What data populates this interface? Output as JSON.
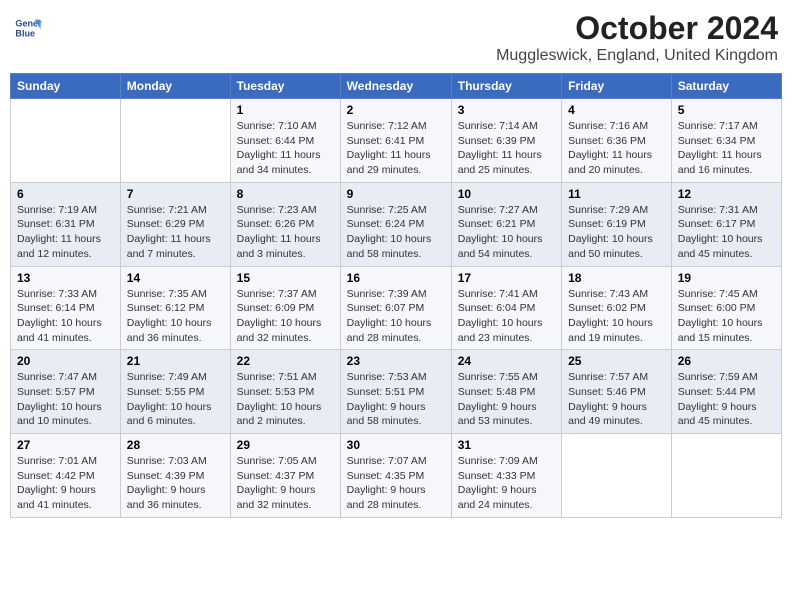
{
  "header": {
    "logo_line1": "General",
    "logo_line2": "Blue",
    "title": "October 2024",
    "subtitle": "Muggleswick, England, United Kingdom"
  },
  "days_of_week": [
    "Sunday",
    "Monday",
    "Tuesday",
    "Wednesday",
    "Thursday",
    "Friday",
    "Saturday"
  ],
  "weeks": [
    [
      {
        "day": "",
        "sunrise": "",
        "sunset": "",
        "daylight": ""
      },
      {
        "day": "",
        "sunrise": "",
        "sunset": "",
        "daylight": ""
      },
      {
        "day": "1",
        "sunrise": "Sunrise: 7:10 AM",
        "sunset": "Sunset: 6:44 PM",
        "daylight": "Daylight: 11 hours and 34 minutes."
      },
      {
        "day": "2",
        "sunrise": "Sunrise: 7:12 AM",
        "sunset": "Sunset: 6:41 PM",
        "daylight": "Daylight: 11 hours and 29 minutes."
      },
      {
        "day": "3",
        "sunrise": "Sunrise: 7:14 AM",
        "sunset": "Sunset: 6:39 PM",
        "daylight": "Daylight: 11 hours and 25 minutes."
      },
      {
        "day": "4",
        "sunrise": "Sunrise: 7:16 AM",
        "sunset": "Sunset: 6:36 PM",
        "daylight": "Daylight: 11 hours and 20 minutes."
      },
      {
        "day": "5",
        "sunrise": "Sunrise: 7:17 AM",
        "sunset": "Sunset: 6:34 PM",
        "daylight": "Daylight: 11 hours and 16 minutes."
      }
    ],
    [
      {
        "day": "6",
        "sunrise": "Sunrise: 7:19 AM",
        "sunset": "Sunset: 6:31 PM",
        "daylight": "Daylight: 11 hours and 12 minutes."
      },
      {
        "day": "7",
        "sunrise": "Sunrise: 7:21 AM",
        "sunset": "Sunset: 6:29 PM",
        "daylight": "Daylight: 11 hours and 7 minutes."
      },
      {
        "day": "8",
        "sunrise": "Sunrise: 7:23 AM",
        "sunset": "Sunset: 6:26 PM",
        "daylight": "Daylight: 11 hours and 3 minutes."
      },
      {
        "day": "9",
        "sunrise": "Sunrise: 7:25 AM",
        "sunset": "Sunset: 6:24 PM",
        "daylight": "Daylight: 10 hours and 58 minutes."
      },
      {
        "day": "10",
        "sunrise": "Sunrise: 7:27 AM",
        "sunset": "Sunset: 6:21 PM",
        "daylight": "Daylight: 10 hours and 54 minutes."
      },
      {
        "day": "11",
        "sunrise": "Sunrise: 7:29 AM",
        "sunset": "Sunset: 6:19 PM",
        "daylight": "Daylight: 10 hours and 50 minutes."
      },
      {
        "day": "12",
        "sunrise": "Sunrise: 7:31 AM",
        "sunset": "Sunset: 6:17 PM",
        "daylight": "Daylight: 10 hours and 45 minutes."
      }
    ],
    [
      {
        "day": "13",
        "sunrise": "Sunrise: 7:33 AM",
        "sunset": "Sunset: 6:14 PM",
        "daylight": "Daylight: 10 hours and 41 minutes."
      },
      {
        "day": "14",
        "sunrise": "Sunrise: 7:35 AM",
        "sunset": "Sunset: 6:12 PM",
        "daylight": "Daylight: 10 hours and 36 minutes."
      },
      {
        "day": "15",
        "sunrise": "Sunrise: 7:37 AM",
        "sunset": "Sunset: 6:09 PM",
        "daylight": "Daylight: 10 hours and 32 minutes."
      },
      {
        "day": "16",
        "sunrise": "Sunrise: 7:39 AM",
        "sunset": "Sunset: 6:07 PM",
        "daylight": "Daylight: 10 hours and 28 minutes."
      },
      {
        "day": "17",
        "sunrise": "Sunrise: 7:41 AM",
        "sunset": "Sunset: 6:04 PM",
        "daylight": "Daylight: 10 hours and 23 minutes."
      },
      {
        "day": "18",
        "sunrise": "Sunrise: 7:43 AM",
        "sunset": "Sunset: 6:02 PM",
        "daylight": "Daylight: 10 hours and 19 minutes."
      },
      {
        "day": "19",
        "sunrise": "Sunrise: 7:45 AM",
        "sunset": "Sunset: 6:00 PM",
        "daylight": "Daylight: 10 hours and 15 minutes."
      }
    ],
    [
      {
        "day": "20",
        "sunrise": "Sunrise: 7:47 AM",
        "sunset": "Sunset: 5:57 PM",
        "daylight": "Daylight: 10 hours and 10 minutes."
      },
      {
        "day": "21",
        "sunrise": "Sunrise: 7:49 AM",
        "sunset": "Sunset: 5:55 PM",
        "daylight": "Daylight: 10 hours and 6 minutes."
      },
      {
        "day": "22",
        "sunrise": "Sunrise: 7:51 AM",
        "sunset": "Sunset: 5:53 PM",
        "daylight": "Daylight: 10 hours and 2 minutes."
      },
      {
        "day": "23",
        "sunrise": "Sunrise: 7:53 AM",
        "sunset": "Sunset: 5:51 PM",
        "daylight": "Daylight: 9 hours and 58 minutes."
      },
      {
        "day": "24",
        "sunrise": "Sunrise: 7:55 AM",
        "sunset": "Sunset: 5:48 PM",
        "daylight": "Daylight: 9 hours and 53 minutes."
      },
      {
        "day": "25",
        "sunrise": "Sunrise: 7:57 AM",
        "sunset": "Sunset: 5:46 PM",
        "daylight": "Daylight: 9 hours and 49 minutes."
      },
      {
        "day": "26",
        "sunrise": "Sunrise: 7:59 AM",
        "sunset": "Sunset: 5:44 PM",
        "daylight": "Daylight: 9 hours and 45 minutes."
      }
    ],
    [
      {
        "day": "27",
        "sunrise": "Sunrise: 7:01 AM",
        "sunset": "Sunset: 4:42 PM",
        "daylight": "Daylight: 9 hours and 41 minutes."
      },
      {
        "day": "28",
        "sunrise": "Sunrise: 7:03 AM",
        "sunset": "Sunset: 4:39 PM",
        "daylight": "Daylight: 9 hours and 36 minutes."
      },
      {
        "day": "29",
        "sunrise": "Sunrise: 7:05 AM",
        "sunset": "Sunset: 4:37 PM",
        "daylight": "Daylight: 9 hours and 32 minutes."
      },
      {
        "day": "30",
        "sunrise": "Sunrise: 7:07 AM",
        "sunset": "Sunset: 4:35 PM",
        "daylight": "Daylight: 9 hours and 28 minutes."
      },
      {
        "day": "31",
        "sunrise": "Sunrise: 7:09 AM",
        "sunset": "Sunset: 4:33 PM",
        "daylight": "Daylight: 9 hours and 24 minutes."
      },
      {
        "day": "",
        "sunrise": "",
        "sunset": "",
        "daylight": ""
      },
      {
        "day": "",
        "sunrise": "",
        "sunset": "",
        "daylight": ""
      }
    ]
  ]
}
